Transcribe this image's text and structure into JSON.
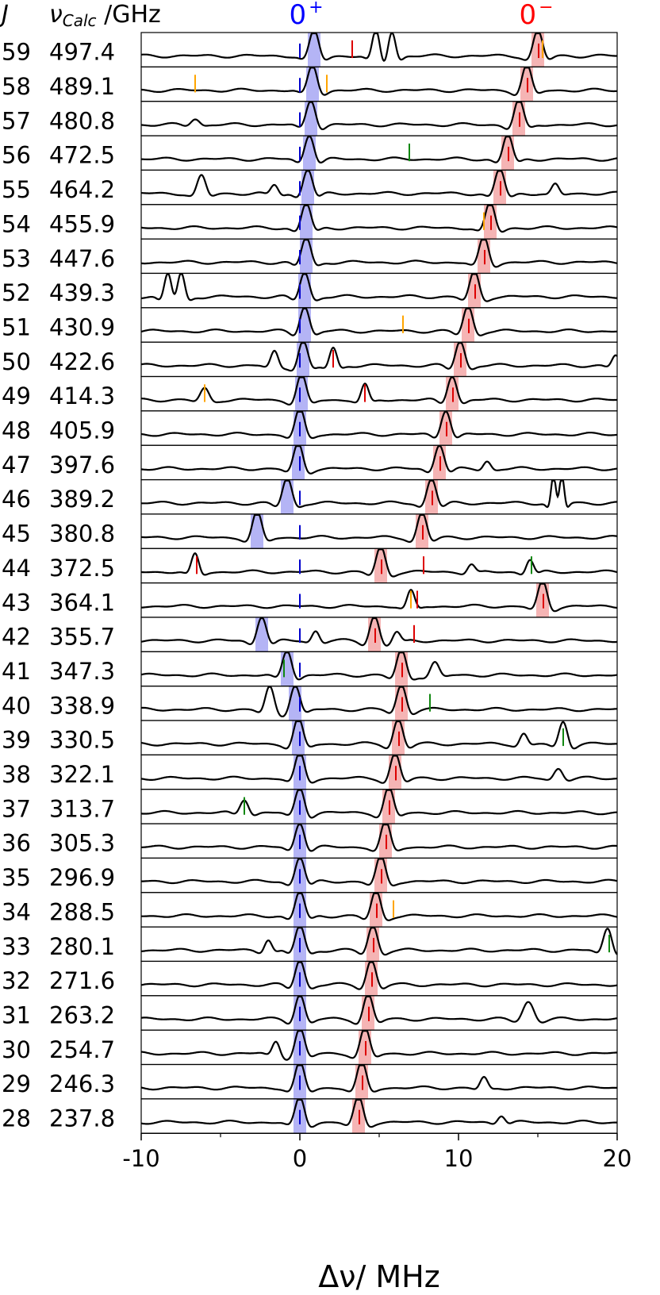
{
  "chart_data": {
    "type": "line",
    "title": "",
    "xlabel": "Δν/ MHz",
    "ylabel": "",
    "header_j": "J",
    "header_nu": "ν",
    "header_nu_sub": "Calc",
    "header_unit": " /GHz",
    "xlim": [
      -10,
      20
    ],
    "xticks": [
      -10,
      0,
      10,
      20
    ],
    "xtick_labels": [
      "-10",
      "0",
      "10",
      "20"
    ],
    "band_labels": [
      {
        "base": "0",
        "sup": "+",
        "x": 0,
        "color": "#0000ff"
      },
      {
        "base": "0",
        "sup": "−",
        "x": 14.5,
        "color": "#ff0000"
      }
    ],
    "colors": {
      "trace": "#000000",
      "plus_band": "#b4b4f5",
      "minus_band": "#f5b4b4",
      "plus_tick": "#0000cc",
      "minus_tick": "#dd0000",
      "orange_tick": "#ffa500",
      "green_tick": "#118811"
    },
    "rows": [
      {
        "J": "59",
        "nu": "497.4",
        "plus": 0.9,
        "minus": 15.0
      },
      {
        "J": "58",
        "nu": "489.1",
        "plus": 0.8,
        "minus": 14.3
      },
      {
        "J": "57",
        "nu": "480.8",
        "plus": 0.7,
        "minus": 13.8
      },
      {
        "J": "56",
        "nu": "472.5",
        "plus": 0.6,
        "minus": 13.1
      },
      {
        "J": "55",
        "nu": "464.2",
        "plus": 0.5,
        "minus": 12.6
      },
      {
        "J": "54",
        "nu": "455.9",
        "plus": 0.4,
        "minus": 12.0
      },
      {
        "J": "53",
        "nu": "447.6",
        "plus": 0.4,
        "minus": 11.6
      },
      {
        "J": "52",
        "nu": "439.3",
        "plus": 0.3,
        "minus": 11.0
      },
      {
        "J": "51",
        "nu": "430.9",
        "plus": 0.3,
        "minus": 10.6
      },
      {
        "J": "50",
        "nu": "422.6",
        "plus": 0.2,
        "minus": 10.1
      },
      {
        "J": "49",
        "nu": "414.3",
        "plus": 0.1,
        "minus": 9.6
      },
      {
        "J": "48",
        "nu": "405.9",
        "plus": 0.0,
        "minus": 9.2
      },
      {
        "J": "47",
        "nu": "397.6",
        "plus": -0.1,
        "minus": 8.8
      },
      {
        "J": "46",
        "nu": "389.2",
        "plus": -0.8,
        "minus": 8.3
      },
      {
        "J": "45",
        "nu": "380.8",
        "plus": -2.7,
        "minus": 7.7
      },
      {
        "J": "44",
        "nu": "372.5",
        "plus": null,
        "minus": 5.1
      },
      {
        "J": "43",
        "nu": "364.1",
        "plus": null,
        "minus": 15.3
      },
      {
        "J": "42",
        "nu": "355.7",
        "plus": -2.4,
        "minus": 4.7
      },
      {
        "J": "41",
        "nu": "347.3",
        "plus": -0.8,
        "minus": 6.4
      },
      {
        "J": "40",
        "nu": "338.9",
        "plus": -0.3,
        "minus": 6.4
      },
      {
        "J": "39",
        "nu": "330.5",
        "plus": -0.1,
        "minus": 6.2
      },
      {
        "J": "38",
        "nu": "322.1",
        "plus": 0.0,
        "minus": 6.0
      },
      {
        "J": "37",
        "nu": "313.7",
        "plus": 0.0,
        "minus": 5.6
      },
      {
        "J": "36",
        "nu": "305.3",
        "plus": 0.0,
        "minus": 5.4
      },
      {
        "J": "35",
        "nu": "296.9",
        "plus": 0.0,
        "minus": 5.1
      },
      {
        "J": "34",
        "nu": "288.5",
        "plus": 0.0,
        "minus": 4.8
      },
      {
        "J": "33",
        "nu": "280.1",
        "plus": 0.0,
        "minus": 4.6
      },
      {
        "J": "32",
        "nu": "271.6",
        "plus": 0.0,
        "minus": 4.5
      },
      {
        "J": "31",
        "nu": "263.2",
        "plus": 0.0,
        "minus": 4.3
      },
      {
        "J": "30",
        "nu": "254.7",
        "plus": 0.0,
        "minus": 4.1
      },
      {
        "J": "29",
        "nu": "246.3",
        "plus": 0.0,
        "minus": 3.9
      },
      {
        "J": "28",
        "nu": "237.8",
        "plus": 0.0,
        "minus": 3.7
      }
    ],
    "extra_ticks": [
      {
        "J": "59",
        "x": 3.3,
        "color": "red"
      },
      {
        "J": "59",
        "x": 15.3,
        "color": "orange"
      },
      {
        "J": "58",
        "x": -6.6,
        "color": "orange"
      },
      {
        "J": "58",
        "x": 1.7,
        "color": "orange"
      },
      {
        "J": "56",
        "x": 6.9,
        "color": "green"
      },
      {
        "J": "54",
        "x": 11.6,
        "color": "orange"
      },
      {
        "J": "51",
        "x": 6.5,
        "color": "orange"
      },
      {
        "J": "50",
        "x": 2.1,
        "color": "red"
      },
      {
        "J": "49",
        "x": -6.0,
        "color": "orange"
      },
      {
        "J": "49",
        "x": 4.1,
        "color": "red"
      },
      {
        "J": "44",
        "x": -6.5,
        "color": "red"
      },
      {
        "J": "44",
        "x": 7.8,
        "color": "red"
      },
      {
        "J": "44",
        "x": 14.6,
        "color": "green"
      },
      {
        "J": "43",
        "x": 7.0,
        "color": "orange"
      },
      {
        "J": "43",
        "x": 7.4,
        "color": "red"
      },
      {
        "J": "42",
        "x": 7.2,
        "color": "red"
      },
      {
        "J": "41",
        "x": -1.0,
        "color": "green"
      },
      {
        "J": "40",
        "x": 8.2,
        "color": "green"
      },
      {
        "J": "39",
        "x": 16.6,
        "color": "green"
      },
      {
        "J": "37",
        "x": -3.5,
        "color": "green"
      },
      {
        "J": "34",
        "x": 5.9,
        "color": "orange"
      },
      {
        "J": "33",
        "x": 19.5,
        "color": "green"
      }
    ],
    "extra_peaks": [
      {
        "J": "59",
        "x": 4.8,
        "h": 1.0,
        "w": 0.3
      },
      {
        "J": "59",
        "x": 5.8,
        "h": 1.0,
        "w": 0.3
      },
      {
        "J": "57",
        "x": -6.6,
        "h": 0.25,
        "w": 0.35
      },
      {
        "J": "55",
        "x": -6.2,
        "h": 0.7,
        "w": 0.35
      },
      {
        "J": "55",
        "x": -1.6,
        "h": 0.35,
        "w": 0.3
      },
      {
        "J": "55",
        "x": 16.1,
        "h": 0.35,
        "w": 0.3
      },
      {
        "J": "52",
        "x": -8.3,
        "h": 1.0,
        "w": 0.3
      },
      {
        "J": "52",
        "x": -7.5,
        "h": 1.0,
        "w": 0.3
      },
      {
        "J": "50",
        "x": -1.6,
        "h": 0.55,
        "w": 0.3
      },
      {
        "J": "50",
        "x": 2.1,
        "h": 0.7,
        "w": 0.3
      },
      {
        "J": "50",
        "x": 19.9,
        "h": 0.4,
        "w": 0.3
      },
      {
        "J": "49",
        "x": -6.0,
        "h": 0.45,
        "w": 0.35
      },
      {
        "J": "49",
        "x": 4.1,
        "h": 0.6,
        "w": 0.3
      },
      {
        "J": "47",
        "x": 11.8,
        "h": 0.3,
        "w": 0.3
      },
      {
        "J": "46",
        "x": 16.0,
        "h": 1.2,
        "w": 0.2
      },
      {
        "J": "46",
        "x": 16.5,
        "h": 1.2,
        "w": 0.2
      },
      {
        "J": "44",
        "x": -6.6,
        "h": 0.7,
        "w": 0.3
      },
      {
        "J": "44",
        "x": 10.8,
        "h": 0.3,
        "w": 0.3
      },
      {
        "J": "44",
        "x": 14.5,
        "h": 0.5,
        "w": 0.3
      },
      {
        "J": "43",
        "x": 7.0,
        "h": 0.6,
        "w": 0.3
      },
      {
        "J": "42",
        "x": 1.0,
        "h": 0.4,
        "w": 0.3
      },
      {
        "J": "42",
        "x": 6.1,
        "h": 0.35,
        "w": 0.3
      },
      {
        "J": "41",
        "x": 8.5,
        "h": 0.5,
        "w": 0.35
      },
      {
        "J": "40",
        "x": -1.9,
        "h": 0.9,
        "w": 0.35
      },
      {
        "J": "39",
        "x": 14.1,
        "h": 0.4,
        "w": 0.3
      },
      {
        "J": "39",
        "x": 16.6,
        "h": 0.9,
        "w": 0.35
      },
      {
        "J": "38",
        "x": 16.3,
        "h": 0.4,
        "w": 0.35
      },
      {
        "J": "37",
        "x": -3.5,
        "h": 0.55,
        "w": 0.35
      },
      {
        "J": "33",
        "x": -2.0,
        "h": 0.45,
        "w": 0.3
      },
      {
        "J": "33",
        "x": 19.4,
        "h": 0.9,
        "w": 0.35
      },
      {
        "J": "31",
        "x": 14.4,
        "h": 0.7,
        "w": 0.45
      },
      {
        "J": "30",
        "x": -1.5,
        "h": 0.5,
        "w": 0.3
      },
      {
        "J": "29",
        "x": 11.6,
        "h": 0.4,
        "w": 0.3
      },
      {
        "J": "28",
        "x": 12.7,
        "h": 0.3,
        "w": 0.3
      }
    ]
  }
}
